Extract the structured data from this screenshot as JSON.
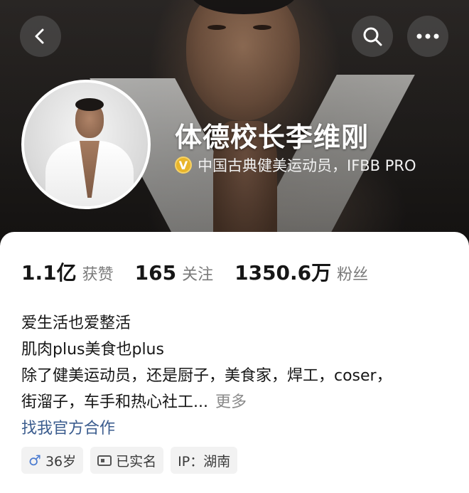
{
  "header": {
    "back_icon": "chevron-left-icon",
    "search_icon": "search-icon",
    "more_icon": "more-horizontal-icon"
  },
  "profile": {
    "name": "体德校长李维刚",
    "verify_badge": "V",
    "verify_text": "中国古典健美运动员，IFBB PRO",
    "badge_color": "#e8b52a"
  },
  "stats": [
    {
      "value": "1.1亿",
      "label": "获赞"
    },
    {
      "value": "165",
      "label": "关注"
    },
    {
      "value": "1350.6万",
      "label": "粉丝"
    }
  ],
  "bio": {
    "lines": [
      "爱生活也爱整活",
      "肌肉plus美食也plus",
      "除了健美运动员，还是厨子，美食家，焊工，coser，",
      "街溜子，车手和热心社工..."
    ],
    "more": "更多",
    "contact": "找我官方合作"
  },
  "tags": {
    "age": "36岁",
    "verified": "已实名",
    "ip": "IP：湖南",
    "gender_icon": "male-icon",
    "id_icon": "id-card-icon"
  },
  "colors": {
    "link": "#3b5c8e",
    "male": "#4a7bd0"
  }
}
